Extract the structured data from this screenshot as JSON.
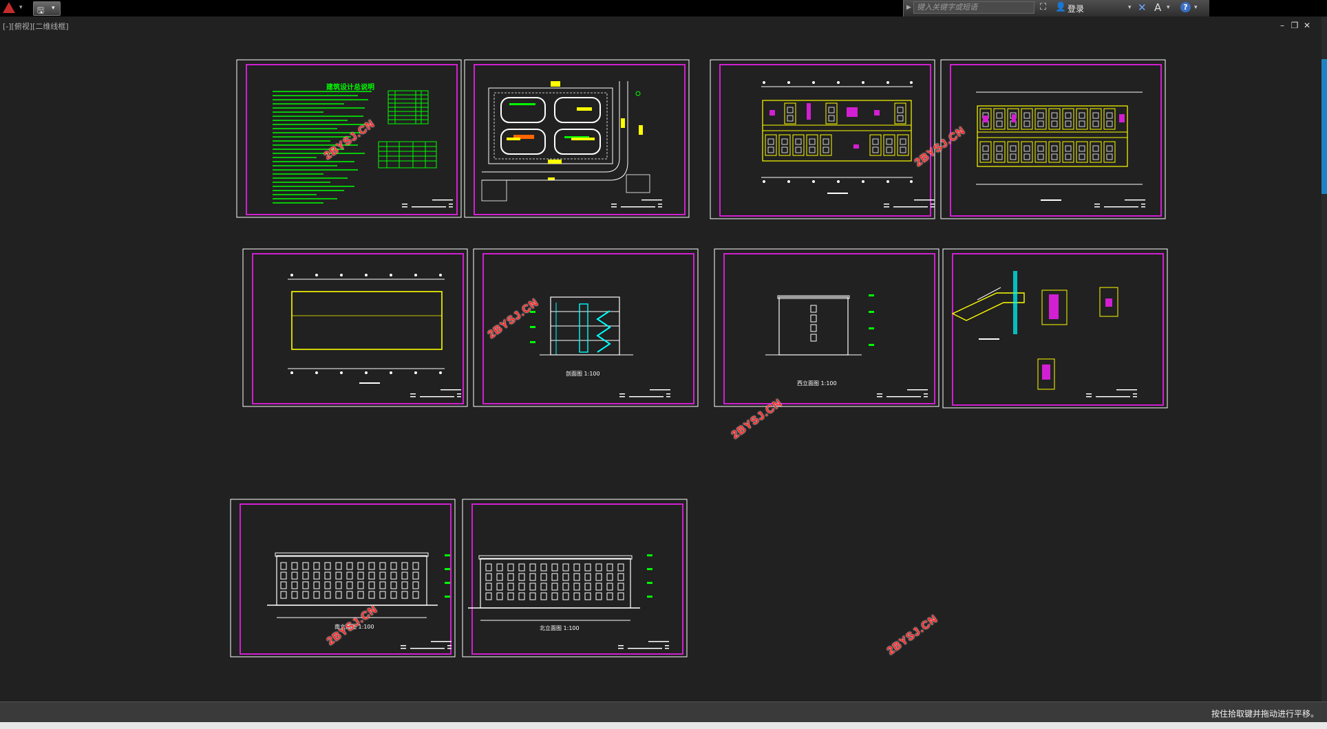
{
  "toolbar": {
    "app_icon": "autocad-logo-icon",
    "qat_icon": "save-icon"
  },
  "infocenter": {
    "search_placeholder": "键入关键字或短语",
    "login_label": "登录",
    "help_label": "?"
  },
  "viewport": {
    "label": "[-][俯视][二维线框]"
  },
  "window_controls": {
    "minimize": "–",
    "restore": "❐",
    "close": "✕"
  },
  "sheets": [
    {
      "name": "sheet-design-notes",
      "title": "建筑设计总说明"
    },
    {
      "name": "sheet-site-plan",
      "title": ""
    },
    {
      "name": "sheet-floor-plan-1",
      "title": ""
    },
    {
      "name": "sheet-floor-plan-2",
      "title": ""
    },
    {
      "name": "sheet-roof-plan",
      "title": ""
    },
    {
      "name": "sheet-section",
      "title": "剖面图 1:100"
    },
    {
      "name": "sheet-side-elevation",
      "title": "西立面图 1:100"
    },
    {
      "name": "sheet-details",
      "title": ""
    },
    {
      "name": "sheet-south-elevation",
      "title": "南立面图 1:100"
    },
    {
      "name": "sheet-north-elevation",
      "title": "北立面图 1:100"
    }
  ],
  "watermark": "2BYSJ.CN",
  "colors": {
    "frame_magenta": "#d21fd2",
    "cad_yellow": "#ffff00",
    "cad_green": "#00ff00",
    "cad_cyan": "#00ffff",
    "accent_blue": "#1c84c6",
    "watermark_red": "#ff2b2b"
  },
  "status": {
    "message": "按住拾取键并拖动进行平移。"
  }
}
